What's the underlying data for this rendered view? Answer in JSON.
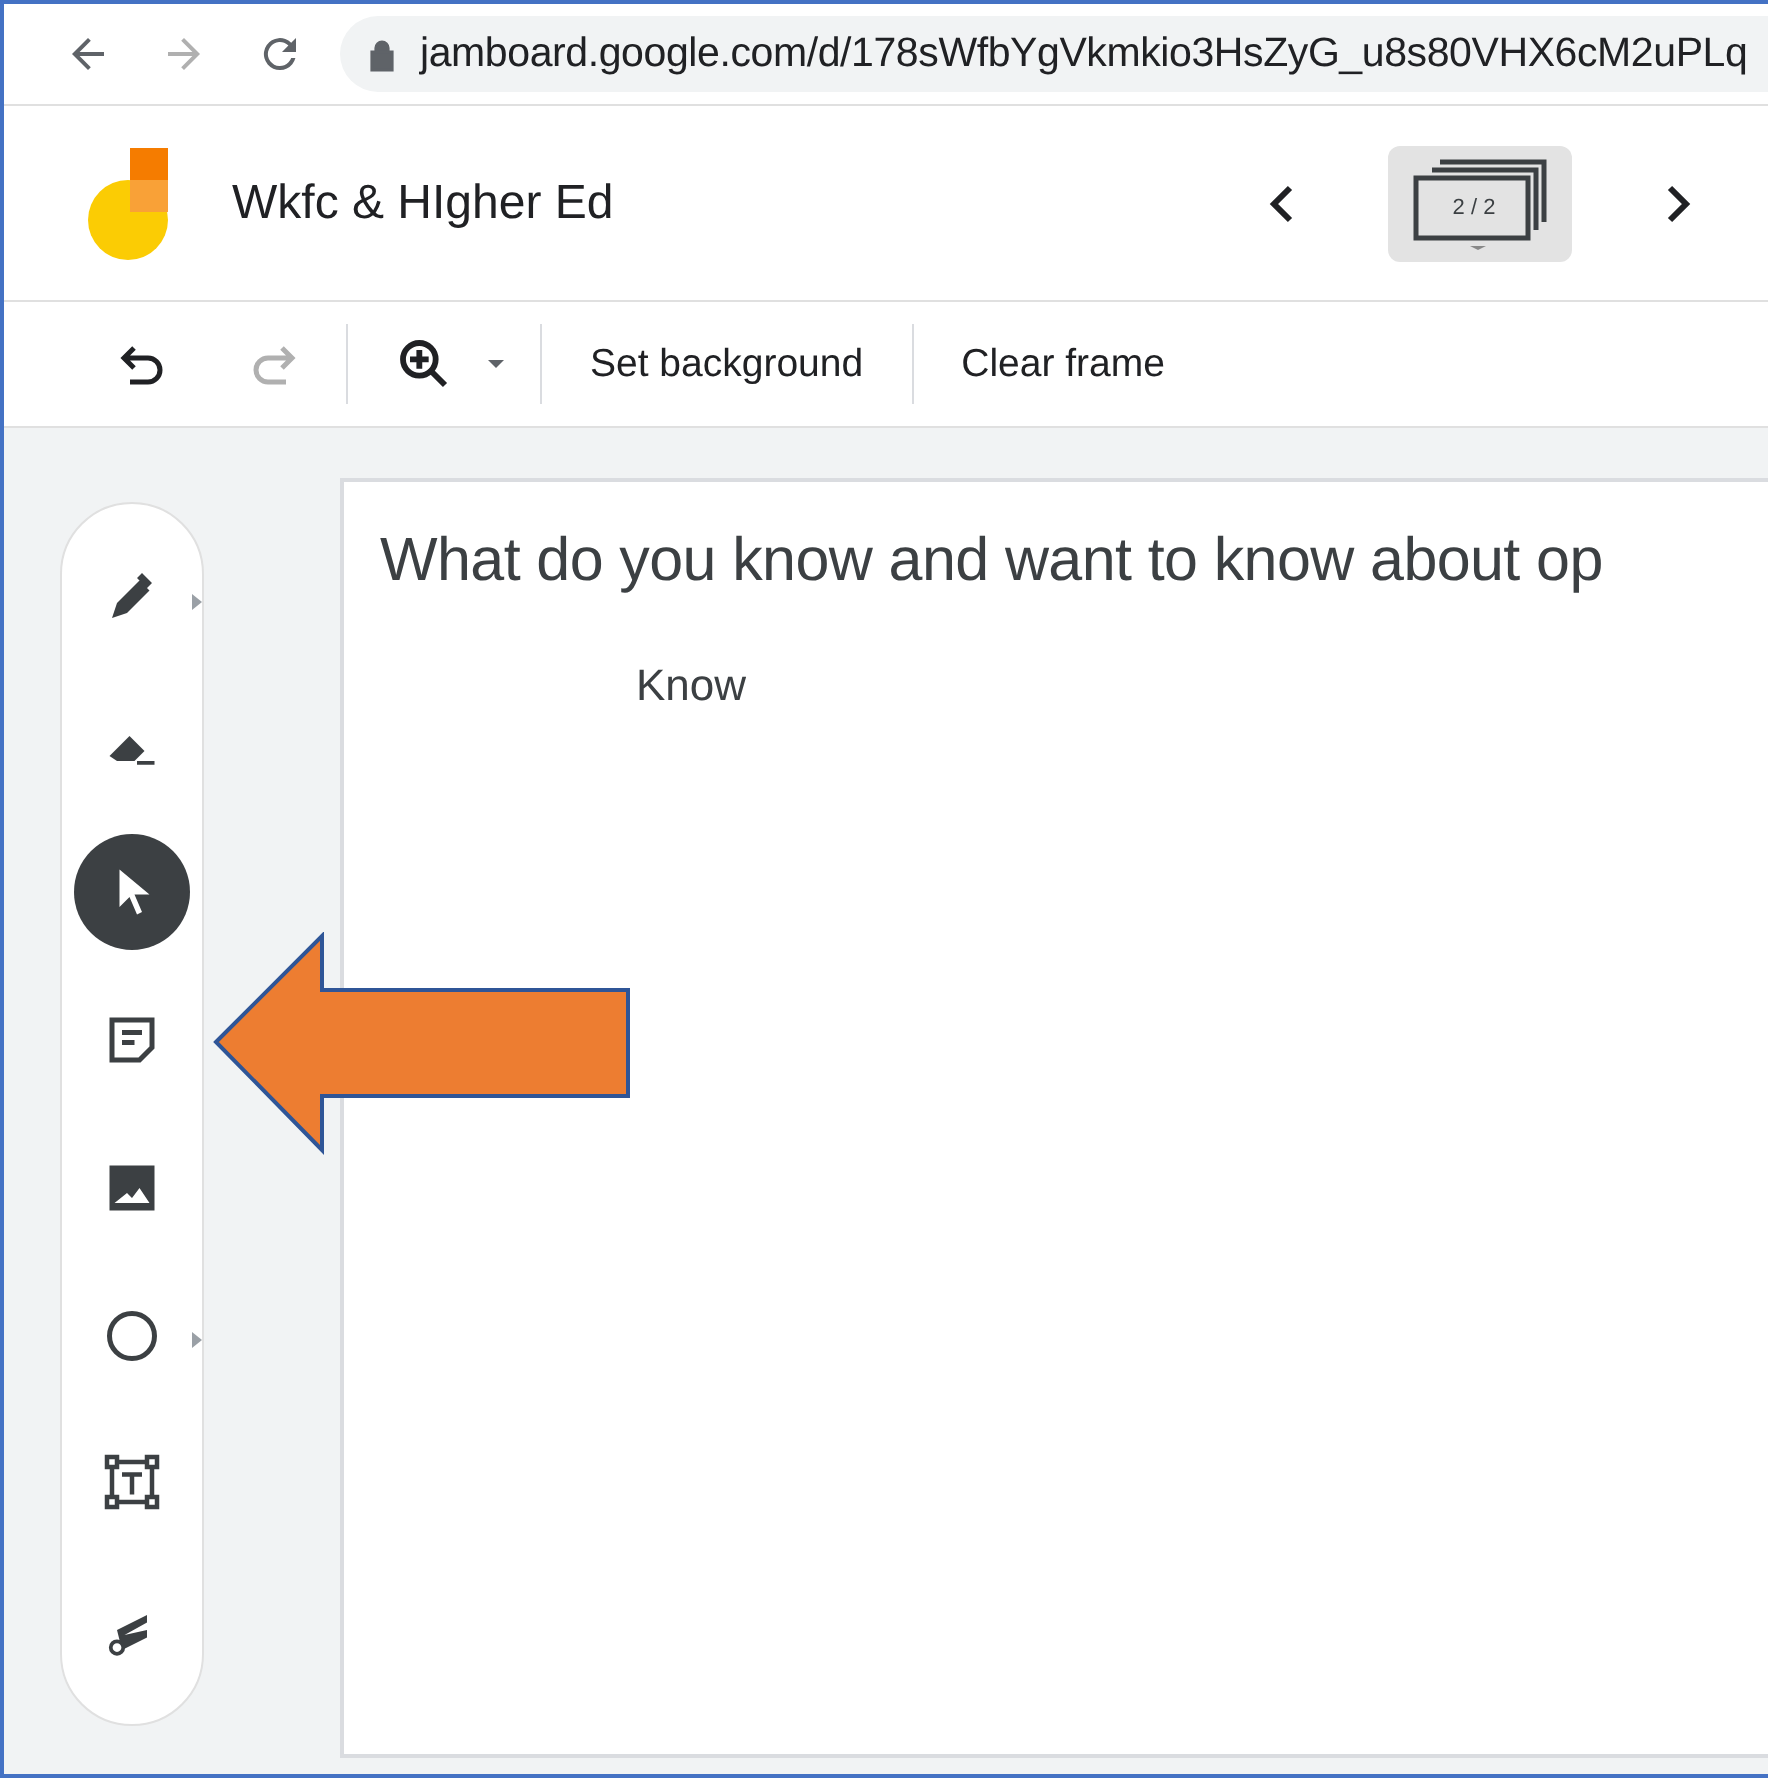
{
  "browser": {
    "url": "jamboard.google.com/d/178sWfbYgVkmkio3HsZyG_u8s80VHX6cM2uPLq"
  },
  "header": {
    "title": "Wkfc & HIgher Ed",
    "frame_counter": "2 / 2"
  },
  "toolbar": {
    "redo_disabled": true,
    "buttons": [
      {
        "label": "Set background"
      },
      {
        "label": "Clear frame"
      }
    ]
  },
  "tools": [
    {
      "kind": "pen",
      "selected": false,
      "has_menu": true
    },
    {
      "kind": "eraser",
      "selected": false,
      "has_menu": false
    },
    {
      "kind": "select",
      "selected": true,
      "has_menu": false
    },
    {
      "kind": "sticky-note",
      "selected": false,
      "has_menu": false
    },
    {
      "kind": "image",
      "selected": false,
      "has_menu": false
    },
    {
      "kind": "circle",
      "selected": false,
      "has_menu": true
    },
    {
      "kind": "text-box",
      "selected": false,
      "has_menu": false
    },
    {
      "kind": "laser",
      "selected": false,
      "has_menu": false
    }
  ],
  "canvas": {
    "heading": "What do you know and want to know about op",
    "label": "Know"
  },
  "annotation": {
    "kind": "arrow"
  }
}
